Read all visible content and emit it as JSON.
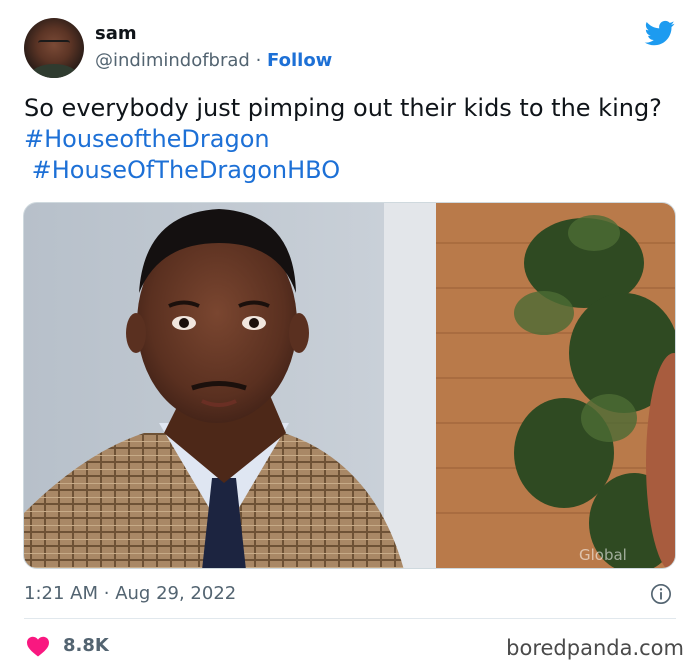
{
  "user": {
    "name": "sam",
    "handle": "@indimindofbrad",
    "separator": "·",
    "follow_label": "Follow"
  },
  "tweet": {
    "text": "So everybody just pimping out their kids to the king?",
    "hashtags": [
      "#HouseoftheDragon",
      "#HouseOfTheDragonHBO"
    ]
  },
  "media": {
    "watermark": "Global"
  },
  "meta": {
    "time": "1:21 AM",
    "separator": "·",
    "date": "Aug 29, 2022"
  },
  "engagement": {
    "likes": "8.8K"
  },
  "footer": {
    "watermark": "boredpanda.com"
  },
  "icons": {
    "brand": "twitter-bird-icon",
    "info": "info-icon",
    "like": "heart-icon"
  },
  "colors": {
    "link": "#1d70d6",
    "twitter_blue": "#1d9bf0",
    "like_red": "#f91880",
    "secondary_text": "#536471"
  }
}
